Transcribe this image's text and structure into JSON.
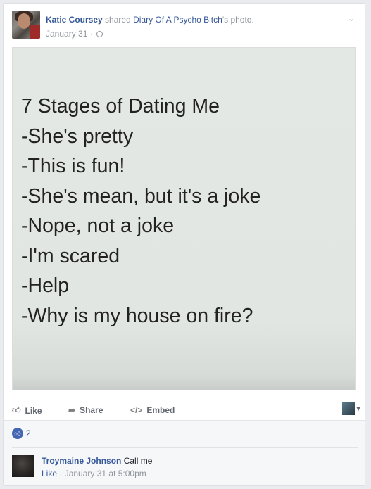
{
  "post": {
    "author": "Katie Coursey",
    "action": "shared",
    "shared_from": "Diary Of A Psycho Bitch",
    "shared_suffix": "'s photo.",
    "date": "January 31",
    "dot": "·"
  },
  "photo": {
    "lines": [
      "7 Stages of Dating Me",
      "-She's pretty",
      "-This is fun!",
      "-She's mean, but it's a joke",
      "-Nope, not a joke",
      "-I'm scared",
      "-Help",
      "-Why is my house on fire?"
    ]
  },
  "actions": {
    "like": "Like",
    "share": "Share",
    "embed": "Embed"
  },
  "reactions": {
    "count": "2"
  },
  "comment": {
    "name": "Troymaine Johnson",
    "text": "Call me",
    "like": "Like",
    "timestamp": "January 31 at 5:00pm",
    "dot": "·"
  },
  "colors": {
    "link": "#365899",
    "muted": "#90949c",
    "like_badge": "#4267b2"
  },
  "icons": [
    "globe-icon",
    "chevron-down-icon",
    "like-icon",
    "share-icon",
    "embed-icon",
    "like-badge-icon",
    "caret-down-icon"
  ]
}
